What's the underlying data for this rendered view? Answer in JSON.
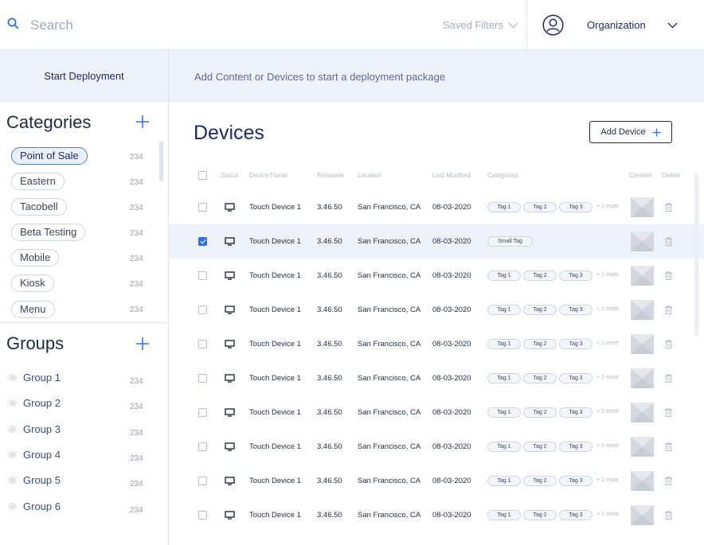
{
  "header": {
    "search_placeholder": "Search",
    "saved_filters": "Saved Filters",
    "organization": "Organization"
  },
  "deploy": {
    "start": "Start Deployment",
    "hint": "Add Content or Devices to start a deployment package"
  },
  "sidebar": {
    "categories_title": "Categories",
    "categories": [
      {
        "label": "Point of Sale",
        "count": "234",
        "active": true
      },
      {
        "label": "Eastern",
        "count": "234"
      },
      {
        "label": "Tacobell",
        "count": "234"
      },
      {
        "label": "Beta Testing",
        "count": "234"
      },
      {
        "label": "Mobile",
        "count": "234"
      },
      {
        "label": "Kiosk",
        "count": "234"
      },
      {
        "label": "Menu",
        "count": "234"
      }
    ],
    "groups_title": "Groups",
    "groups": [
      {
        "label": "Group 1",
        "count": "234"
      },
      {
        "label": "Group 2",
        "count": "234"
      },
      {
        "label": "Group 3",
        "count": "234"
      },
      {
        "label": "Group 4",
        "count": "234"
      },
      {
        "label": "Group 5",
        "count": "234"
      },
      {
        "label": "Group 6",
        "count": "234"
      }
    ]
  },
  "main": {
    "title": "Devices",
    "add_device": "Add Device",
    "columns": {
      "status": "Status",
      "device_name": "Device Name",
      "firmware": "Firmware",
      "location": "Location",
      "last_modified": "Last Modified",
      "categories": "Categories",
      "content": "Content",
      "delete": "Delete"
    },
    "rows": [
      {
        "name": "Touch Device 1",
        "firmware": "3.46.50",
        "location": "San Francisco, CA",
        "modified": "08-03-2020",
        "tags": [
          "Tag 1",
          "Tag 2",
          "Tag 3"
        ],
        "more": "+ 1 more",
        "checked": false
      },
      {
        "name": "Touch Device 1",
        "firmware": "3.46.50",
        "location": "San Francisco, CA",
        "modified": "08-03-2020",
        "tags": [
          "Small Tag"
        ],
        "more": "",
        "checked": true
      },
      {
        "name": "Touch Device 1",
        "firmware": "3.46.50",
        "location": "San Francisco, CA",
        "modified": "08-03-2020",
        "tags": [
          "Tag 1",
          "Tag 2",
          "Tag 3"
        ],
        "more": "+ 1 more",
        "checked": false
      },
      {
        "name": "Touch Device 1",
        "firmware": "3.46.50",
        "location": "San Francisco, CA",
        "modified": "08-03-2020",
        "tags": [
          "Tag 1",
          "Tag 2",
          "Tag 3"
        ],
        "more": "+ 1 more",
        "checked": false
      },
      {
        "name": "Touch Device 1",
        "firmware": "3.46.50",
        "location": "San Francisco, CA",
        "modified": "08-03-2020",
        "tags": [
          "Tag 1",
          "Tag 2",
          "Tag 3"
        ],
        "more": "+ 1 more",
        "checked": false
      },
      {
        "name": "Touch Device 1",
        "firmware": "3.46.50",
        "location": "San Francisco, CA",
        "modified": "08-03-2020",
        "tags": [
          "Tag 1",
          "Tag 2",
          "Tag 3"
        ],
        "more": "+ 1 more",
        "checked": false
      },
      {
        "name": "Touch Device 1",
        "firmware": "3.46.50",
        "location": "San Francisco, CA",
        "modified": "08-03-2020",
        "tags": [
          "Tag 1",
          "Tag 2",
          "Tag 3"
        ],
        "more": "+ 1 more",
        "checked": false
      },
      {
        "name": "Touch Device 1",
        "firmware": "3.46.50",
        "location": "San Francisco, CA",
        "modified": "08-03-2020",
        "tags": [
          "Tag 1",
          "Tag 2",
          "Tag 3"
        ],
        "more": "+ 1 more",
        "checked": false
      },
      {
        "name": "Touch Device 1",
        "firmware": "3.46.50",
        "location": "San Francisco, CA",
        "modified": "08-03-2020",
        "tags": [
          "Tag 1",
          "Tag 2",
          "Tag 3"
        ],
        "more": "+ 1 more",
        "checked": false
      },
      {
        "name": "Touch Device 1",
        "firmware": "3.46.50",
        "location": "San Francisco, CA",
        "modified": "08-03-2020",
        "tags": [
          "Tag 1",
          "Tag 2",
          "Tag 3"
        ],
        "more": "+ 1 more",
        "checked": false
      }
    ]
  },
  "icons": {
    "search": "search-icon",
    "chevron": "chevron-down-icon",
    "avatar": "user-icon",
    "plus": "plus-icon",
    "group": "gear-icon",
    "device": "monitor-icon",
    "content": "image-placeholder-icon",
    "delete": "trash-icon"
  },
  "colors": {
    "accent": "#2f6fe0",
    "navy": "#1f2a6b",
    "deploy_bg": "#eef2fa",
    "selected_row": "#eef2fa"
  }
}
